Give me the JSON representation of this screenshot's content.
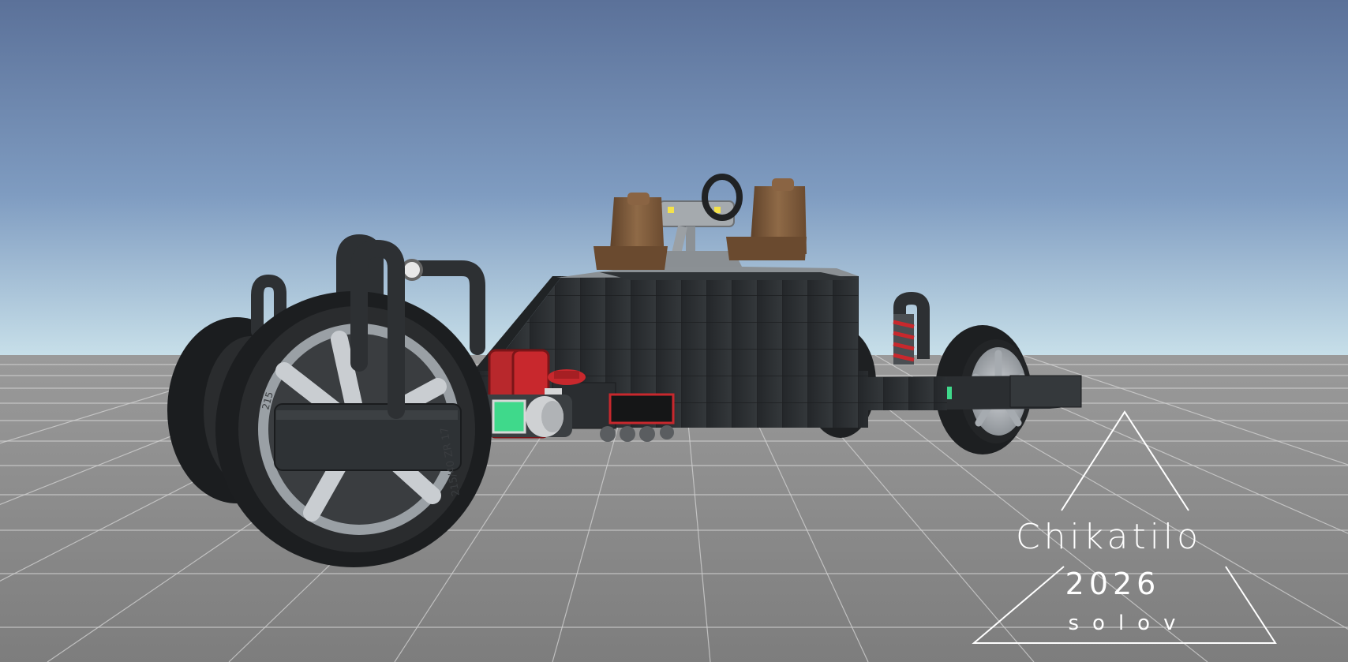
{
  "scene": {
    "sky_top_color": "#5b7199",
    "sky_horizon_color": "#bcd4e4",
    "ground_color": "#8a8a8a",
    "grid_color": "#c8c8c8",
    "chassis_color": "#2e3133",
    "accent_red": "#c8282d",
    "accent_green": "#3fd98b",
    "seat_color": "#7a583a"
  },
  "watermark": {
    "title": "Chikatilo",
    "year": "2026",
    "subtitle": "solov"
  },
  "tire": {
    "sidewall_text_1": "215/40 ZR 17",
    "sidewall_text_2": "215"
  }
}
